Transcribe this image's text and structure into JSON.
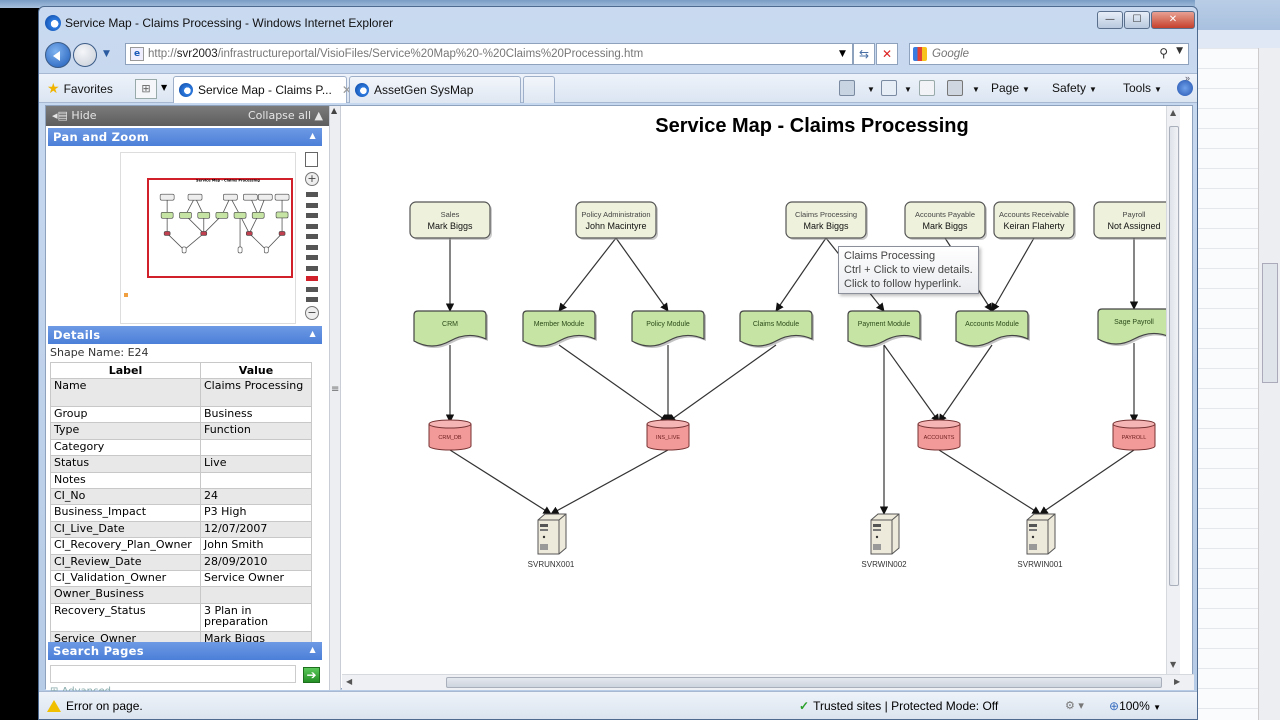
{
  "window": {
    "title": "Service Map - Claims Processing - Windows Internet Explorer",
    "url_prefix": "http://",
    "url_host": "svr2003",
    "url_path": "/infrastructureportal/VisioFiles/Service%20Map%20-%20Claims%20Processing.htm",
    "search_placeholder": "Google",
    "minimize": "—",
    "maximize": "☐",
    "close": "✕"
  },
  "favorites_bar": {
    "favorites_label": "Favorites",
    "tabs": [
      {
        "label": "Service Map - Claims P...",
        "active": true
      },
      {
        "label": "AssetGen SysMap",
        "active": false
      }
    ],
    "commands": [
      "Page",
      "Safety",
      "Tools"
    ]
  },
  "sidebar": {
    "hide_label": "Hide",
    "collapse_all_label": "Collapse all ▲",
    "pan_zoom_title": "Pan and Zoom",
    "zoom_levels": 11,
    "zoom_selected_index": 8,
    "details_title": "Details",
    "shape_name": "Shape Name: E24",
    "table_headers": [
      "Label",
      "Value"
    ],
    "rows": [
      {
        "label": "Name",
        "value": "Claims Processing"
      },
      {
        "label": "Group",
        "value": "Business"
      },
      {
        "label": "Type",
        "value": "Function"
      },
      {
        "label": "Category",
        "value": ""
      },
      {
        "label": "Status",
        "value": "Live"
      },
      {
        "label": "Notes",
        "value": ""
      },
      {
        "label": "CI_No",
        "value": "24"
      },
      {
        "label": "Business_Impact",
        "value": "P3 High"
      },
      {
        "label": "CI_Live_Date",
        "value": "12/07/2007"
      },
      {
        "label": "CI_Recovery_Plan_Owner",
        "value": "John Smith"
      },
      {
        "label": "CI_Review_Date",
        "value": "28/09/2010"
      },
      {
        "label": "CI_Validation_Owner",
        "value": "Service Owner"
      },
      {
        "label": "Owner_Business",
        "value": ""
      },
      {
        "label": "Recovery_Status",
        "value": "3 Plan in preparation"
      },
      {
        "label": "Service_Owner",
        "value": "Mark Biggs"
      }
    ],
    "search_title": "Search Pages",
    "search_value": "",
    "advanced_label": "Advanced"
  },
  "diagram": {
    "title": "Service Map - Claims Processing",
    "business_nodes": [
      {
        "id": "sales",
        "name": "Sales",
        "owner": "Mark Biggs"
      },
      {
        "id": "poladmin",
        "name": "Policy Administration",
        "owner": "John Macintyre"
      },
      {
        "id": "claims",
        "name": "Claims Processing",
        "owner": "Mark Biggs"
      },
      {
        "id": "ap",
        "name": "Accounts Payable",
        "owner": "Mark Biggs"
      },
      {
        "id": "ar",
        "name": "Accounts Receivable",
        "owner": "Keiran Flaherty"
      },
      {
        "id": "payroll",
        "name": "Payroll",
        "owner": "Not Assigned"
      }
    ],
    "app_nodes": [
      {
        "id": "crm",
        "name": "CRM"
      },
      {
        "id": "member",
        "name": "Member Module"
      },
      {
        "id": "policy",
        "name": "Policy Module"
      },
      {
        "id": "claimsmod",
        "name": "Claims Module"
      },
      {
        "id": "payment",
        "name": "Payment Module"
      },
      {
        "id": "accounts",
        "name": "Accounts Module"
      },
      {
        "id": "sage",
        "name": "Sage Payroll"
      }
    ],
    "db_nodes": [
      {
        "id": "crmdb",
        "name": "CRM_DB"
      },
      {
        "id": "inslive",
        "name": "INS_LIVE"
      },
      {
        "id": "accdb",
        "name": "ACCOUNTS"
      },
      {
        "id": "paydb",
        "name": "PAYROLL"
      }
    ],
    "server_nodes": [
      {
        "id": "unx1",
        "name": "SVRUNX001"
      },
      {
        "id": "win2",
        "name": "SVRWIN002"
      },
      {
        "id": "win1",
        "name": "SVRWIN001"
      }
    ],
    "edges": [
      [
        "sales",
        "crm"
      ],
      [
        "poladmin",
        "member"
      ],
      [
        "poladmin",
        "policy"
      ],
      [
        "claims",
        "claimsmod"
      ],
      [
        "claims",
        "payment"
      ],
      [
        "ap",
        "accounts"
      ],
      [
        "ar",
        "accounts"
      ],
      [
        "payroll",
        "sage"
      ],
      [
        "crm",
        "crmdb"
      ],
      [
        "member",
        "inslive"
      ],
      [
        "policy",
        "inslive"
      ],
      [
        "claimsmod",
        "inslive"
      ],
      [
        "payment",
        "accdb"
      ],
      [
        "accounts",
        "accdb"
      ],
      [
        "payment",
        "win2"
      ],
      [
        "sage",
        "paydb"
      ],
      [
        "crmdb",
        "unx1"
      ],
      [
        "inslive",
        "unx1"
      ],
      [
        "accdb",
        "win1"
      ],
      [
        "paydb",
        "win1"
      ]
    ],
    "tooltip": [
      "Claims Processing",
      "Ctrl + Click to view details.",
      "Click to follow hyperlink."
    ],
    "colors": {
      "business_fill": "#eef2dc",
      "app_fill": "#c6e5a4",
      "db_fill": "#f29a9a",
      "edge": "#333333"
    }
  },
  "status_bar": {
    "error_text": "Error on page.",
    "zone_text": "Trusted sites | Protected Mode: Off",
    "zoom_text": "100%"
  }
}
